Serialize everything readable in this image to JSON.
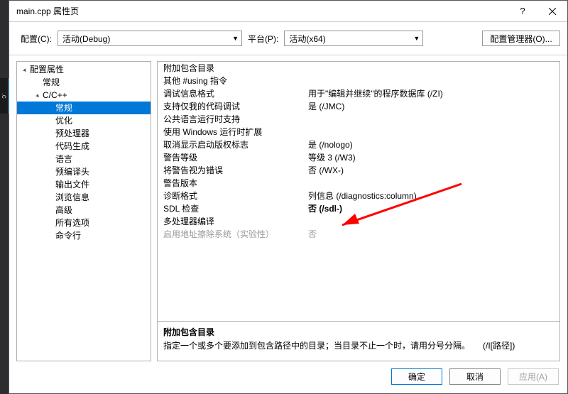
{
  "title": "main.cpp 属性页",
  "left_strip_tab": ".c",
  "config_bar": {
    "config_label": "配置(C):",
    "config_value": "活动(Debug)",
    "platform_label": "平台(P):",
    "platform_value": "活动(x64)",
    "manager_button": "配置管理器(O)..."
  },
  "tree": [
    {
      "label": "配置属性",
      "indent": 0,
      "arrow": "▸",
      "rot": true
    },
    {
      "label": "常规",
      "indent": 1
    },
    {
      "label": "C/C++",
      "indent": 1,
      "arrow": "▸",
      "rot": true
    },
    {
      "label": "常规",
      "indent": 2,
      "selected": true
    },
    {
      "label": "优化",
      "indent": 2
    },
    {
      "label": "预处理器",
      "indent": 2
    },
    {
      "label": "代码生成",
      "indent": 2
    },
    {
      "label": "语言",
      "indent": 2
    },
    {
      "label": "预编译头",
      "indent": 2
    },
    {
      "label": "输出文件",
      "indent": 2
    },
    {
      "label": "浏览信息",
      "indent": 2
    },
    {
      "label": "高级",
      "indent": 2
    },
    {
      "label": "所有选项",
      "indent": 2
    },
    {
      "label": "命令行",
      "indent": 2
    }
  ],
  "properties": [
    {
      "name": "附加包含目录",
      "value": ""
    },
    {
      "name": "其他 #using 指令",
      "value": ""
    },
    {
      "name": "调试信息格式",
      "value": "用于\"编辑并继续\"的程序数据库 (/ZI)"
    },
    {
      "name": "支持仅我的代码调试",
      "value": "是 (/JMC)"
    },
    {
      "name": "公共语言运行时支持",
      "value": ""
    },
    {
      "name": "使用 Windows 运行时扩展",
      "value": ""
    },
    {
      "name": "取消显示启动版权标志",
      "value": "是 (/nologo)"
    },
    {
      "name": "警告等级",
      "value": "等级 3 (/W3)"
    },
    {
      "name": "将警告视为错误",
      "value": "否 (/WX-)"
    },
    {
      "name": "警告版本",
      "value": ""
    },
    {
      "name": "诊断格式",
      "value": "列信息 (/diagnostics:column)"
    },
    {
      "name": "SDL 检查",
      "value": "否 (/sdl-)",
      "bold": true
    },
    {
      "name": "多处理器编译",
      "value": ""
    },
    {
      "name": "启用地址擦除系统（实验性）",
      "value": "否",
      "disabled": true
    }
  ],
  "description": {
    "title": "附加包含目录",
    "text": "指定一个或多个要添加到包含路径中的目录；当目录不止一个时，请用分号分隔。　　(/I[路径])"
  },
  "footer": {
    "ok": "确定",
    "cancel": "取消",
    "apply": "应用(A)"
  }
}
